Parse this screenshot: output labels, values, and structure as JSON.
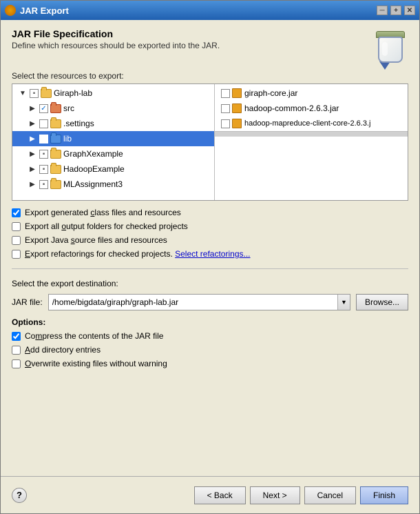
{
  "window": {
    "title": "JAR Export",
    "title_icon": "jar-icon"
  },
  "header": {
    "title": "JAR File Specification",
    "subtitle": "Define which resources should be exported into the JAR."
  },
  "resources_section": {
    "label": "Select the resources to export:",
    "tree_items": [
      {
        "id": "giraph-lab",
        "label": "Giraph-lab",
        "indent": 0,
        "expanded": true,
        "checkbox": "partial",
        "has_expander": true
      },
      {
        "id": "src",
        "label": "src",
        "indent": 1,
        "expanded": false,
        "checkbox": "checked",
        "has_expander": true,
        "type": "src"
      },
      {
        "id": "settings",
        "label": ".settings",
        "indent": 1,
        "expanded": false,
        "checkbox": "unchecked",
        "has_expander": true,
        "type": "folder"
      },
      {
        "id": "lib",
        "label": "lib",
        "indent": 1,
        "expanded": false,
        "checkbox": "unchecked",
        "has_expander": true,
        "type": "folder",
        "selected": true
      },
      {
        "id": "GraphXexample",
        "label": "GraphXexample",
        "indent": 1,
        "expanded": false,
        "checkbox": "partial",
        "has_expander": true,
        "type": "project"
      },
      {
        "id": "HadoopExample",
        "label": "HadoopExample",
        "indent": 1,
        "expanded": false,
        "checkbox": "partial",
        "has_expander": true,
        "type": "project"
      },
      {
        "id": "MLAssignment3",
        "label": "MLAssignment3",
        "indent": 1,
        "expanded": false,
        "checkbox": "partial",
        "has_expander": true,
        "type": "project"
      }
    ],
    "jar_items": [
      {
        "id": "giraph-core",
        "label": "giraph-core.jar",
        "checkbox": "unchecked"
      },
      {
        "id": "hadoop-common",
        "label": "hadoop-common-2.6.3.jar",
        "checkbox": "unchecked"
      },
      {
        "id": "hadoop-mapreduce",
        "label": "hadoop-mapreduce-client-core-2.6.3.j",
        "checkbox": "unchecked"
      }
    ]
  },
  "export_options": {
    "class_files": {
      "label": "Export generated class files and resources",
      "checked": true
    },
    "output_folders": {
      "label": "Export all output folders for checked projects",
      "checked": false
    },
    "source_files": {
      "label": "Export Java source files and resources",
      "checked": false
    },
    "refactorings": {
      "label": "Export refactorings for checked projects.",
      "checked": false,
      "link": "Select refactorings..."
    }
  },
  "destination": {
    "section_label": "Select the export destination:",
    "jar_label": "JAR file:",
    "jar_path": "/home/bigdata/giraph/graph-lab.jar",
    "browse_label": "Browse..."
  },
  "jar_options": {
    "section_label": "Options:",
    "compress": {
      "label": "Compress the contents of the JAR file",
      "checked": true
    },
    "add_directory": {
      "label": "Add directory entries",
      "checked": false
    },
    "overwrite": {
      "label": "Overwrite existing files without warning",
      "checked": false
    }
  },
  "buttons": {
    "help": "?",
    "back": "< Back",
    "next": "Next >",
    "cancel": "Cancel",
    "finish": "Finish"
  }
}
